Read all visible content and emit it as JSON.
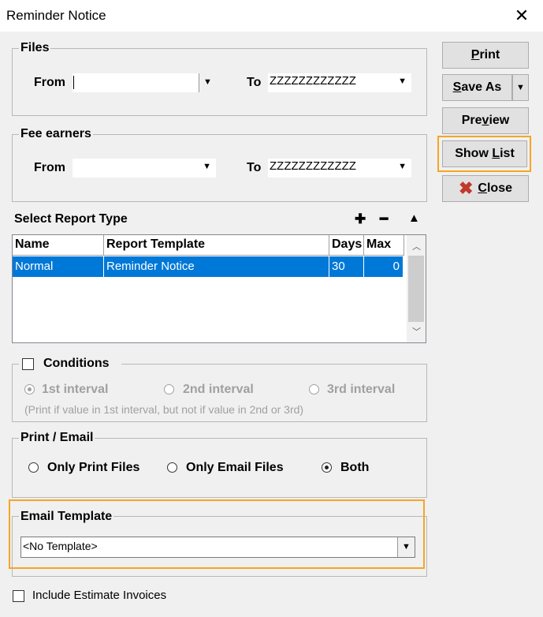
{
  "window": {
    "title": "Reminder Notice",
    "close_glyph": "✕"
  },
  "files": {
    "legend": "Files",
    "from_label": "From",
    "from_value": "",
    "to_label": "To",
    "to_value": "ZZZZZZZZZZZZ"
  },
  "fee_earners": {
    "legend": "Fee earners",
    "from_label": "From",
    "from_value": "",
    "to_label": "To",
    "to_value": "ZZZZZZZZZZZZ"
  },
  "buttons": {
    "print": "Print",
    "save_as": "Save As",
    "preview": "Preview",
    "show_list": "Show List",
    "close": "Close"
  },
  "report_type": {
    "label": "Select Report Type",
    "add_glyph": "✚",
    "remove_glyph": "━",
    "up_glyph": "▲",
    "columns": [
      "Name",
      "Report Template",
      "Days",
      "Max"
    ],
    "rows": [
      {
        "name": "Normal",
        "template": "Reminder Notice",
        "days": "30",
        "max": "0"
      }
    ]
  },
  "conditions": {
    "label": "Conditions",
    "checked": false,
    "intervals": [
      "1st interval",
      "2nd interval",
      "3rd interval"
    ],
    "selected_interval": 0,
    "note": "(Print if value in 1st interval, but not if value in 2nd or 3rd)"
  },
  "print_email": {
    "legend": "Print / Email",
    "options": [
      "Only Print Files",
      "Only Email Files",
      "Both"
    ],
    "selected": 2
  },
  "email_template": {
    "legend": "Email Template",
    "value": "<No Template>"
  },
  "include_estimate": {
    "label": "Include Estimate Invoices",
    "checked": false
  },
  "colors": {
    "selection": "#0078d7",
    "highlight": "#f5a623",
    "close_x": "#c0392b"
  },
  "icons": {
    "close_button": "red-x-icon",
    "dropdown": "chevron-down-icon"
  }
}
